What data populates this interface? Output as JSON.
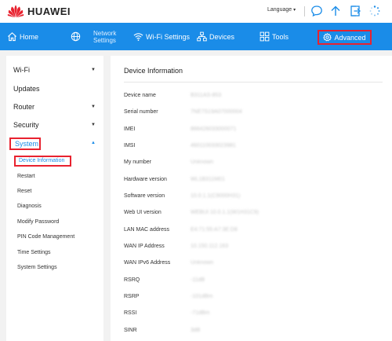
{
  "brand": {
    "name": "HUAWEI",
    "logo_color": "#e8222f"
  },
  "header": {
    "language_label": "Language",
    "accent": "#1a8ce8"
  },
  "nav": {
    "home": "Home",
    "network_settings_line1": "Network",
    "network_settings_line2": "Settings",
    "wifi_settings": "Wi-Fi Settings",
    "devices": "Devices",
    "tools": "Tools",
    "advanced": "Advanced"
  },
  "sidebar": {
    "wifi": "Wi-Fi",
    "updates": "Updates",
    "router": "Router",
    "security": "Security",
    "system": "System",
    "sub": {
      "device_information": "Device Information",
      "restart": "Restart",
      "reset": "Reset",
      "diagnosis": "Diagnosis",
      "modify_password": "Modify Password",
      "pin_code_management": "PIN Code Management",
      "time_settings": "Time Settings",
      "system_settings": "System Settings"
    }
  },
  "content": {
    "title": "Device Information",
    "rows": [
      {
        "label": "Device name",
        "value": "B311AS-853"
      },
      {
        "label": "Serial number",
        "value": "7NE7S19A07000004"
      },
      {
        "label": "IMEI",
        "value": "866426033000071"
      },
      {
        "label": "IMSI",
        "value": "460110033023981"
      },
      {
        "label": "My number",
        "value": "Unknown"
      },
      {
        "label": "Hardware version",
        "value": "WL1B311M01"
      },
      {
        "label": "Software version",
        "value": "10.0.1.1(C9000H31)"
      },
      {
        "label": "Web UI version",
        "value": "WEBUI 10.0.1.1(W1H31C9)"
      },
      {
        "label": "LAN MAC address",
        "value": "E4:71:55:A7:3E:D8"
      },
      {
        "label": "WAN IP Address",
        "value": "10.150.112.163"
      },
      {
        "label": "WAN IPv6 Address",
        "value": "Unknown"
      },
      {
        "label": "RSRQ",
        "value": "-11dB"
      },
      {
        "label": "RSRP",
        "value": "-101dBm"
      },
      {
        "label": "RSSI",
        "value": "-71dBm"
      },
      {
        "label": "SINR",
        "value": "3dB"
      }
    ]
  }
}
